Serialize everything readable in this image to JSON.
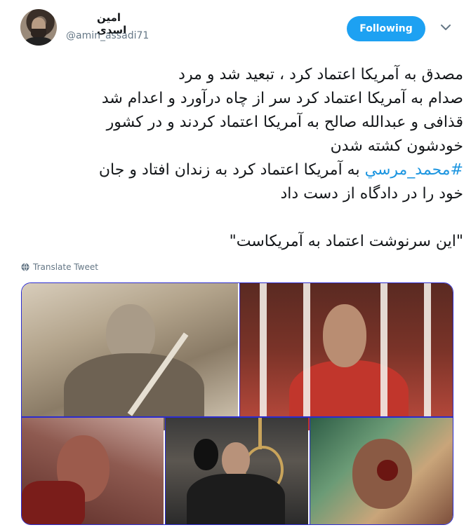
{
  "author": {
    "display_name": "امین اسدی",
    "handle": "@amin_assadi71"
  },
  "follow_button": {
    "label": "Following"
  },
  "icons": {
    "caret": "chevron-down-icon",
    "globe": "globe-icon"
  },
  "tweet": {
    "lines": [
      "مصدق به آمریکا اعتماد کرد ، تبعید شد و مرد",
      "صدام به آمریکا اعتماد کرد سر از چاه درآورد و اعدام شد",
      "قذافی و عبدالله صالح به آمریکا اعتماد کردند و در کشور",
      "خودشون کشته شدن"
    ],
    "hashtag": "#محمد_مرسي",
    "hashtag_rest": " به آمریکا اعتماد کرد به زندان افتاد و جان",
    "line6": "خود را در دادگاه از دست داد",
    "quote": "\"این سرنوشت اعتماد به آمریکاست\""
  },
  "translate_label": "Translate Tweet",
  "colors": {
    "accent": "#1da1f2",
    "hashtag": "#1b95e0",
    "muted": "#657786",
    "photo_border": "#2b2bd0"
  }
}
